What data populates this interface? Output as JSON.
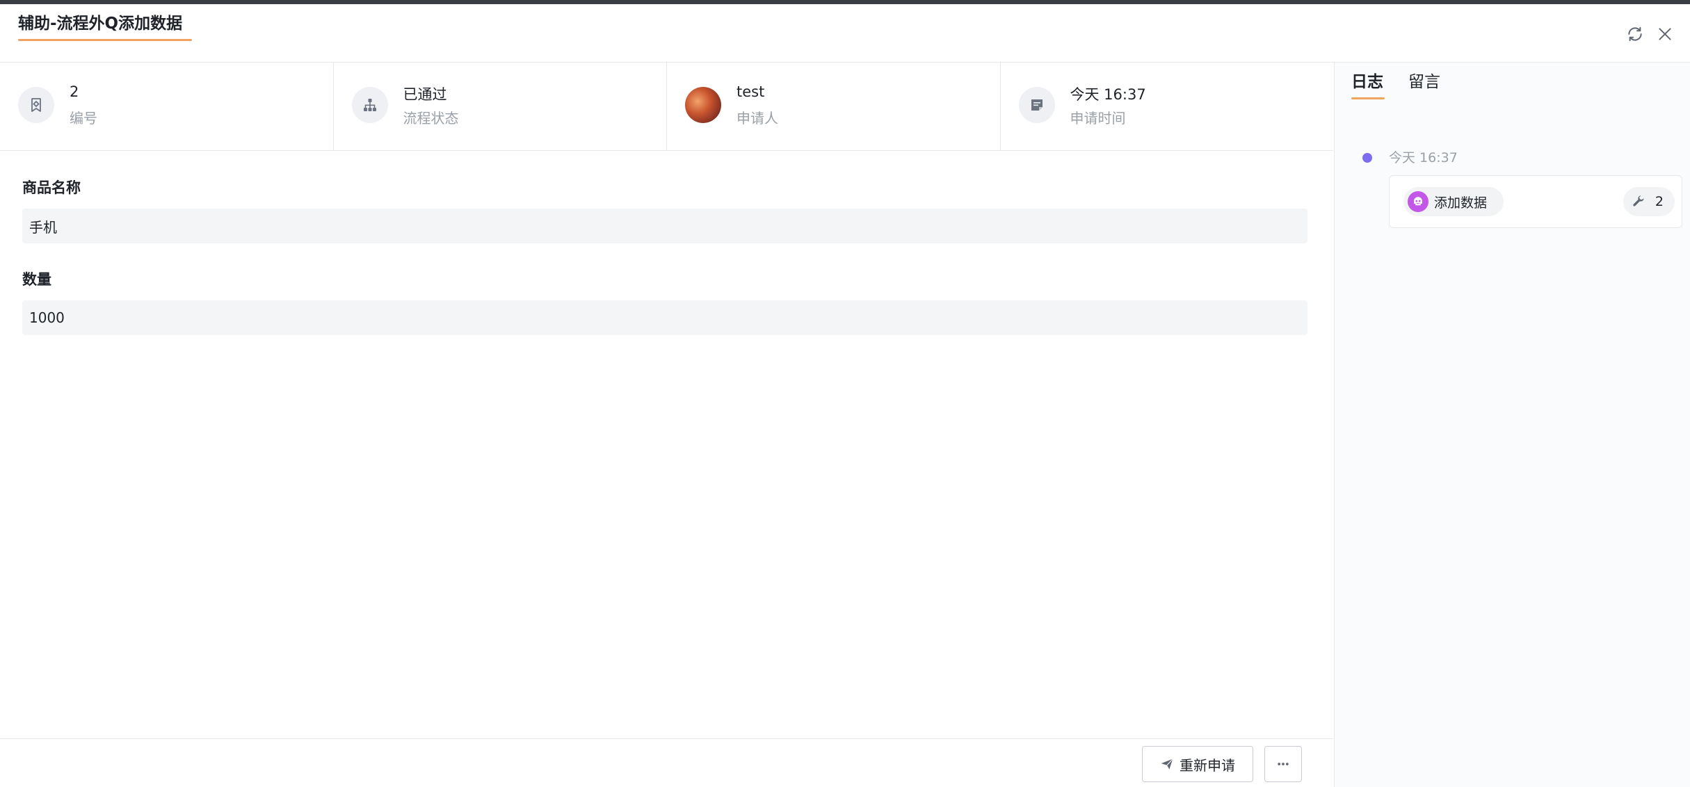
{
  "header": {
    "title": "辅助-流程外Q添加数据",
    "refresh_icon": "refresh-icon",
    "close_icon": "close-icon",
    "accent": "#f0a35e"
  },
  "info": [
    {
      "value": "2",
      "label": "编号",
      "icon": "bookmark-icon"
    },
    {
      "value": "已通过",
      "label": "流程状态",
      "icon": "org-chart-icon"
    },
    {
      "value": "test",
      "label": "申请人",
      "icon": "avatar"
    },
    {
      "value": "今天 16:37",
      "label": "申请时间",
      "icon": "calendar-edit-icon"
    }
  ],
  "form": {
    "fields": [
      {
        "label": "商品名称",
        "value": "手机"
      },
      {
        "label": "数量",
        "value": "1000"
      }
    ]
  },
  "footer": {
    "reapply_label": "重新申请",
    "reapply_icon": "send-icon",
    "more_icon": "more-icon"
  },
  "sidebar": {
    "tabs": [
      {
        "label": "日志",
        "active": true
      },
      {
        "label": "留言",
        "active": false
      }
    ],
    "timeline": [
      {
        "time": "今天 16:37",
        "action": "添加数据",
        "action_icon": "robot-icon",
        "count": "2",
        "count_icon": "wrench-icon",
        "dot_color": "#7d6cf0"
      }
    ]
  }
}
